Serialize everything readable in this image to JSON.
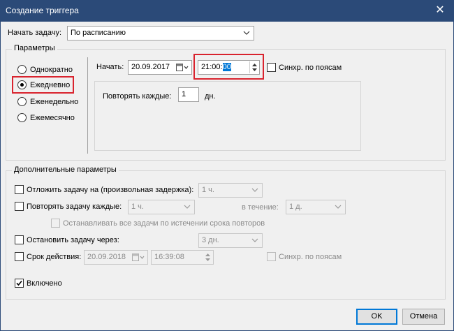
{
  "window": {
    "title": "Создание триггера",
    "close_symbol": "✕"
  },
  "begin_task": {
    "label": "Начать задачу:",
    "value": "По расписанию"
  },
  "params": {
    "title": "Параметры",
    "schedule_options": [
      {
        "label": "Однократно",
        "checked": false
      },
      {
        "label": "Ежедневно",
        "checked": true
      },
      {
        "label": "Еженедельно",
        "checked": false
      },
      {
        "label": "Ежемесячно",
        "checked": false
      }
    ],
    "start_label": "Начать:",
    "start_date": "20.09.2017",
    "start_time_prefix": "21:00:",
    "start_time_selected": "00",
    "sync_label": "Синхр. по поясам",
    "repeat_label": "Повторять каждые:",
    "repeat_value": "1",
    "repeat_unit": "дн."
  },
  "advanced": {
    "title": "Дополнительные параметры",
    "delay": {
      "label": "Отложить задачу на (произвольная задержка):",
      "value": "1 ч."
    },
    "repeat": {
      "label": "Повторять задачу каждые:",
      "value": "1 ч.",
      "during_label": "в течение:",
      "during_value": "1 д."
    },
    "stop_all": {
      "label": "Останавливать все задачи по истечении срока повторов"
    },
    "stop_after": {
      "label": "Остановить задачу через:",
      "value": "3 дн."
    },
    "expire": {
      "label": "Срок действия:",
      "date": "20.09.2018",
      "time": "16:39:08",
      "sync_label": "Синхр. по поясам"
    },
    "enabled": {
      "label": "Включено",
      "checked": true
    }
  },
  "buttons": {
    "ok": "OK",
    "cancel": "Отмена"
  },
  "colors": {
    "titlebar": "#2b4a78",
    "highlight": "#d9232e",
    "selection": "#0078d7"
  }
}
